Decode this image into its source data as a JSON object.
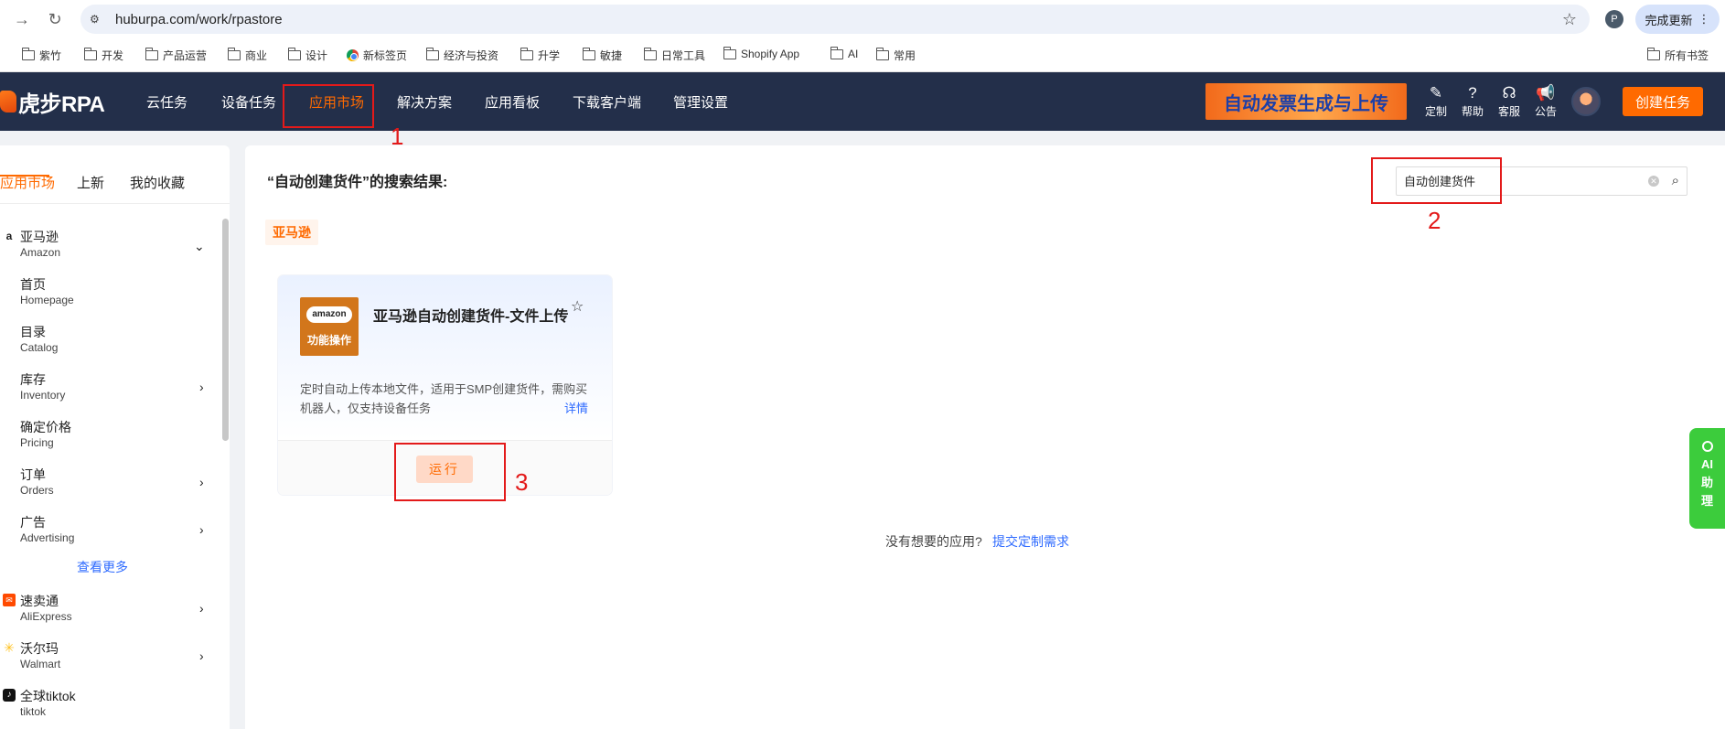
{
  "browser": {
    "url": "huburpa.com/work/rpastore",
    "profile_initial": "P",
    "update_label": "完成更新",
    "bookmarks": [
      "紫竹",
      "开发",
      "产品运营",
      "商业",
      "设计",
      "新标签页",
      "经济与投资",
      "升学",
      "敏捷",
      "日常工具",
      "Shopify App",
      "AI",
      "常用"
    ],
    "all_bookmarks": "所有书签"
  },
  "header": {
    "logo_text": "虎步RPA",
    "nav": [
      "云任务",
      "设备任务",
      "应用市场",
      "解决方案",
      "应用看板",
      "下载客户端",
      "管理设置"
    ],
    "active_nav": "应用市场",
    "banner": "自动发票生成与上传",
    "tools": [
      {
        "label": "定制",
        "icon": "edit-icon"
      },
      {
        "label": "帮助",
        "icon": "help-icon"
      },
      {
        "label": "客服",
        "icon": "headset-icon"
      },
      {
        "label": "公告",
        "icon": "megaphone-icon"
      }
    ],
    "create_task": "创建任务"
  },
  "sidebar": {
    "tabs": [
      "应用市场",
      "上新",
      "我的收藏"
    ],
    "amazon": {
      "zh": "亚马逊",
      "en": "Amazon"
    },
    "amazon_items": [
      {
        "zh": "首页",
        "en": "Homepage"
      },
      {
        "zh": "目录",
        "en": "Catalog"
      },
      {
        "zh": "库存",
        "en": "Inventory"
      },
      {
        "zh": "确定价格",
        "en": "Pricing"
      },
      {
        "zh": "订单",
        "en": "Orders"
      },
      {
        "zh": "广告",
        "en": "Advertising"
      }
    ],
    "see_more": "查看更多",
    "platforms": [
      {
        "zh": "速卖通",
        "en": "AliExpress"
      },
      {
        "zh": "沃尔玛",
        "en": "Walmart"
      },
      {
        "zh": "全球tiktok",
        "en": "tiktok"
      }
    ]
  },
  "main": {
    "result_title": "“自动创建货件”的搜索结果:",
    "search_value": "自动创建货件",
    "category_tag": "亚马逊",
    "card": {
      "logo_pill": "amazon",
      "logo_text": "功能操作",
      "name": "亚马逊自动创建货件-文件上传",
      "description": "定时自动上传本地文件，适用于SMP创建货件，需购买机器人，仅支持设备任务",
      "detail": "详情",
      "run": "运行"
    },
    "no_app_text": "没有想要的应用?",
    "no_app_link": "提交定制需求"
  },
  "ai_assistant": {
    "line1": "AI",
    "line2": "助",
    "line3": "理"
  },
  "annotations": [
    "1",
    "2",
    "3"
  ],
  "colors": {
    "accent": "#ff6a00",
    "header_bg": "#232f4a",
    "link": "#2f6bff",
    "annotation": "#e31a1a"
  }
}
